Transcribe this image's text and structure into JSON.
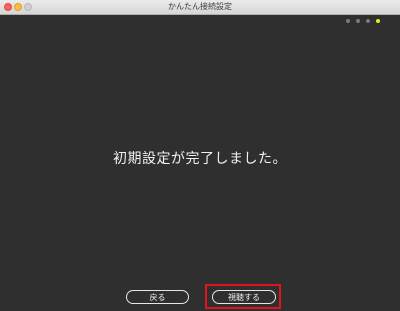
{
  "window": {
    "title": "かんたん接続設定"
  },
  "progress": {
    "steps_total": 4,
    "current_step": 4
  },
  "message": "初期設定が完了しました。",
  "buttons": {
    "back_label": "戻る",
    "watch_label": "視聴する"
  },
  "colors": {
    "accent_dot": "#e8ea1f",
    "highlight_border": "#e0141b",
    "background": "#2f2f2f"
  }
}
